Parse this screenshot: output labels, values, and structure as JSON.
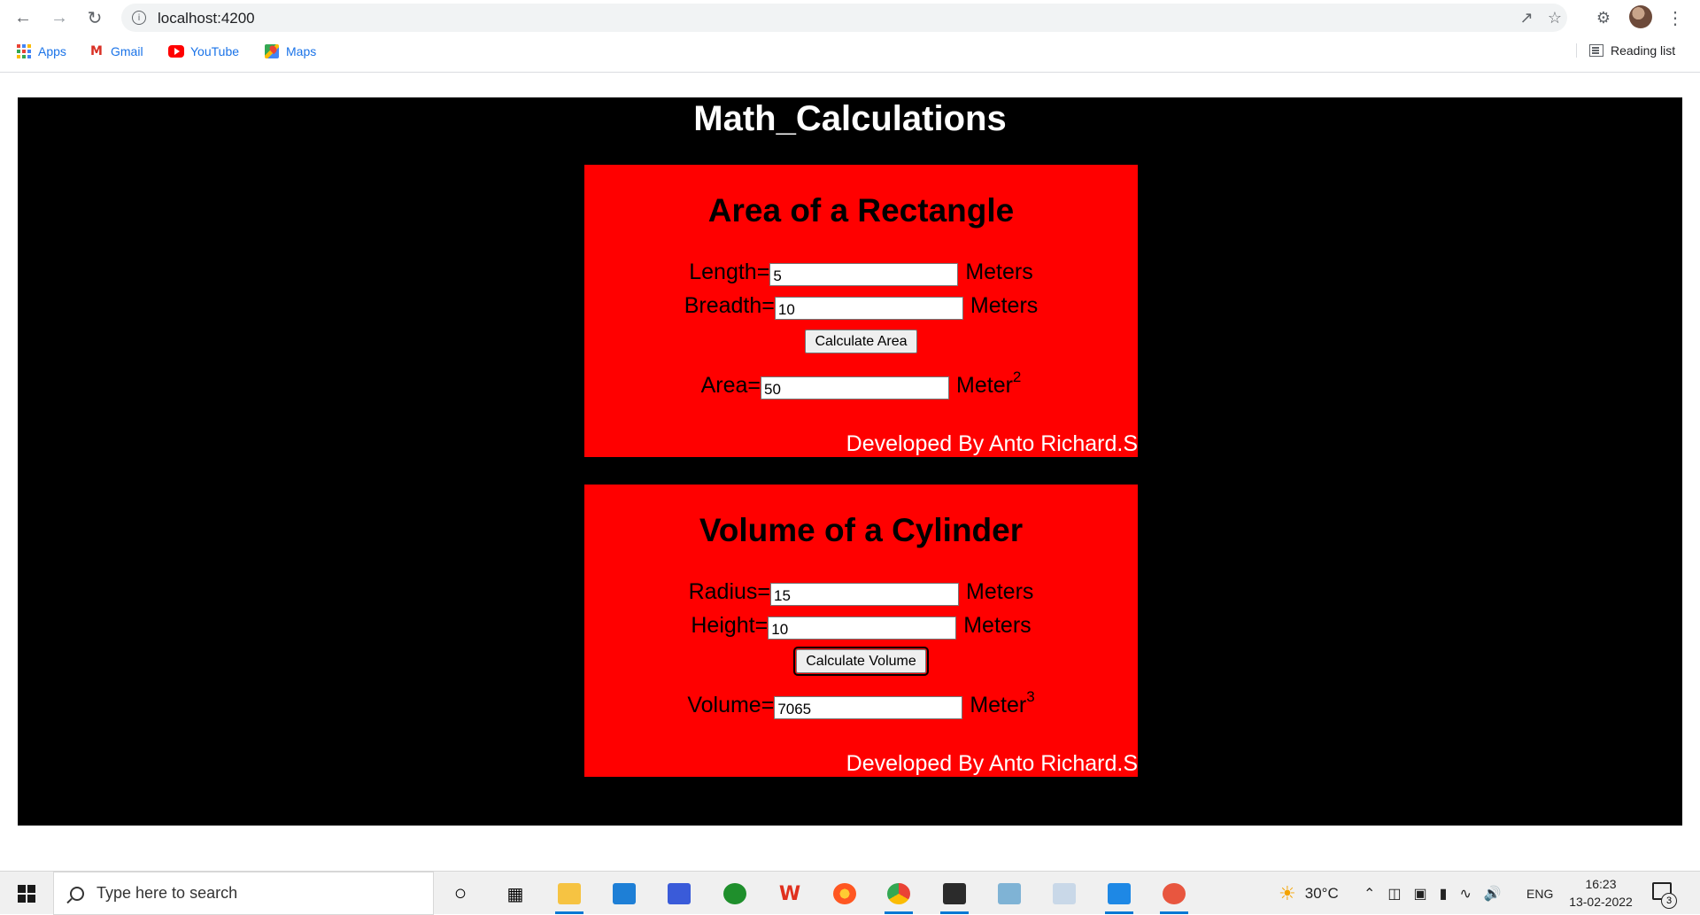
{
  "browser": {
    "url": "localhost:4200",
    "bookmarks": [
      {
        "label": "Apps",
        "icon": "apps-grid-icon"
      },
      {
        "label": "Gmail",
        "icon": "gmail-icon"
      },
      {
        "label": "YouTube",
        "icon": "youtube-icon"
      },
      {
        "label": "Maps",
        "icon": "maps-icon"
      }
    ],
    "reading_list": "Reading list"
  },
  "app": {
    "title": "Math_Calculations"
  },
  "rectangle": {
    "title": "Area of a Rectangle",
    "length_label": "Length=",
    "length_value": "5",
    "length_unit": "Meters",
    "breadth_label": "Breadth=",
    "breadth_value": "10",
    "breadth_unit": "Meters",
    "button_label": "Calculate Area",
    "area_label": "Area=",
    "area_value": "50",
    "area_unit": "Meter",
    "area_unit_exp": "2",
    "footer": "Developed By Anto Richard.S"
  },
  "cylinder": {
    "title": "Volume of a Cylinder",
    "radius_label": "Radius=",
    "radius_value": "15",
    "radius_unit": "Meters",
    "height_label": "Height=",
    "height_value": "10",
    "height_unit": "Meters",
    "button_label": "Calculate Volume",
    "volume_label": "Volume=",
    "volume_value": "7065",
    "volume_unit": "Meter",
    "volume_unit_exp": "3",
    "footer": "Developed By Anto Richard.S"
  },
  "taskbar": {
    "search_placeholder": "Type here to search",
    "weather": "30°C",
    "language": "ENG",
    "time": "16:23",
    "date": "13-02-2022",
    "notification_count": "3"
  }
}
